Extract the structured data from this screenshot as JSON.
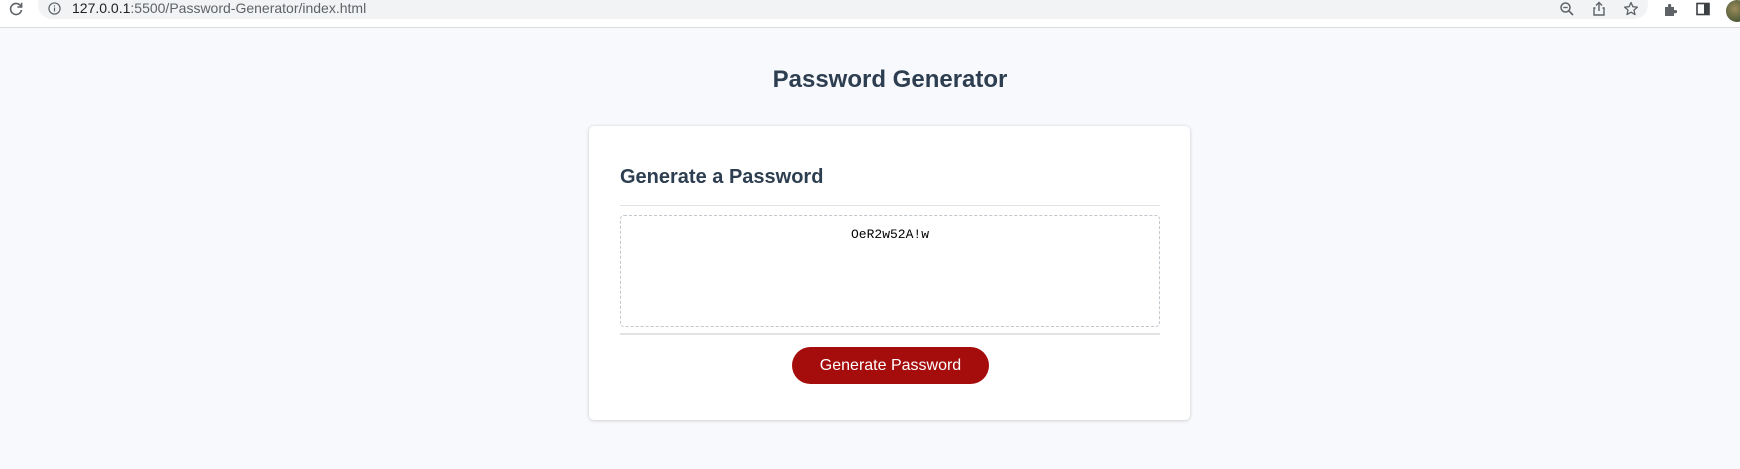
{
  "browser": {
    "url_host": "127.0.0.1",
    "url_rest": ":5500/Password-Generator/index.html"
  },
  "header": {
    "title": "Password Generator"
  },
  "card": {
    "title": "Generate a Password",
    "password": "OeR2w52A!w",
    "generate_label": "Generate Password"
  },
  "colors": {
    "accent": "#a50d0d",
    "heading": "#2d3e50",
    "background": "#f8f9fc"
  }
}
